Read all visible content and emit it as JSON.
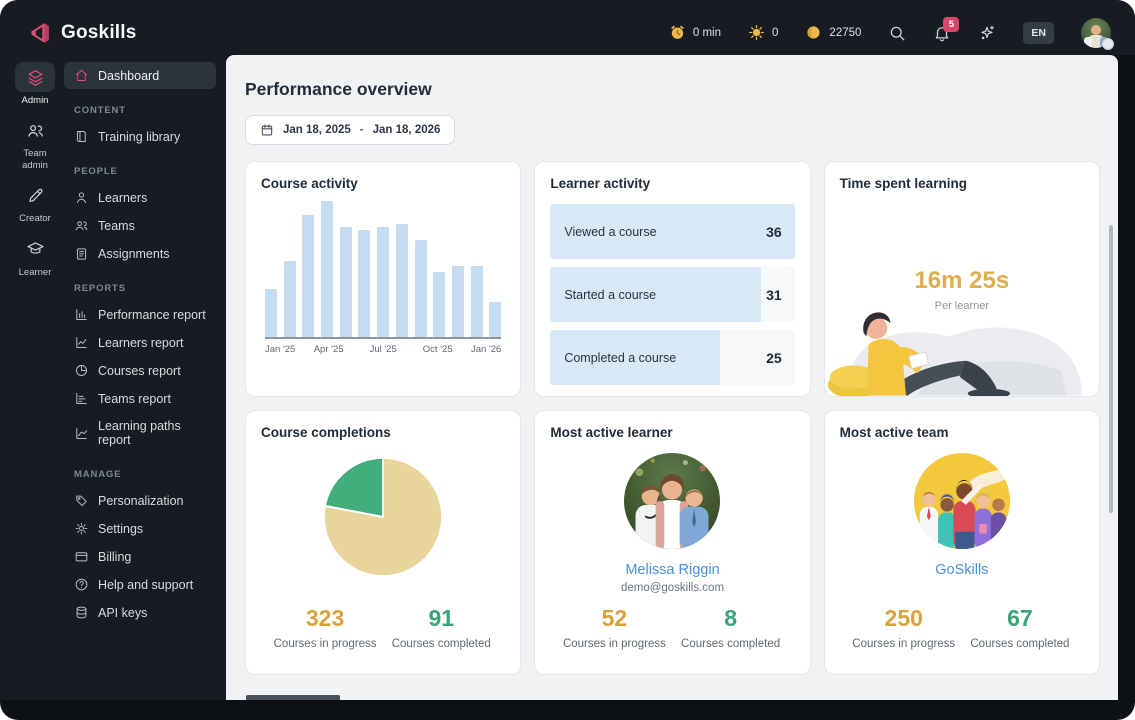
{
  "colors": {
    "accent": "#d94f72",
    "gold": "#d9a23c",
    "green": "#3aa475",
    "link_blue": "#4a90d8",
    "bar_blue": "#c4dbf0",
    "badge_red": "#d6466b"
  },
  "topbar": {
    "brand": "Goskills",
    "counters": [
      {
        "icon": "clock-icon",
        "label": "0 min"
      },
      {
        "icon": "sun-icon",
        "label": "0"
      },
      {
        "icon": "coin-icon",
        "label": "22750"
      }
    ],
    "notification_count": "5",
    "language": "EN"
  },
  "rail": {
    "items": [
      {
        "label": "Admin",
        "icon": "layers-icon",
        "active": true
      },
      {
        "label": "Team admin",
        "icon": "people-icon",
        "active": false
      },
      {
        "label": "Creator",
        "icon": "pencil-icon",
        "active": false
      },
      {
        "label": "Learner",
        "icon": "graduation-cap-icon",
        "active": false
      }
    ]
  },
  "sidebar": {
    "top_item": {
      "label": "Dashboard",
      "icon": "home-icon",
      "active": true
    },
    "sections": [
      {
        "header": "CONTENT",
        "items": [
          {
            "label": "Training library",
            "icon": "book-icon"
          }
        ]
      },
      {
        "header": "PEOPLE",
        "items": [
          {
            "label": "Learners",
            "icon": "person-icon"
          },
          {
            "label": "Teams",
            "icon": "people-icon"
          },
          {
            "label": "Assignments",
            "icon": "clipboard-icon"
          }
        ]
      },
      {
        "header": "REPORTS",
        "items": [
          {
            "label": "Performance report",
            "icon": "bar-chart-icon"
          },
          {
            "label": "Learners report",
            "icon": "line-chart-icon"
          },
          {
            "label": "Courses report",
            "icon": "pie-chart-icon"
          },
          {
            "label": "Teams report",
            "icon": "hbar-chart-icon"
          },
          {
            "label": "Learning paths report",
            "icon": "trend-chart-icon"
          }
        ]
      },
      {
        "header": "MANAGE",
        "items": [
          {
            "label": "Personalization",
            "icon": "tag-icon"
          },
          {
            "label": "Settings",
            "icon": "gear-icon"
          },
          {
            "label": "Billing",
            "icon": "credit-card-icon"
          },
          {
            "label": "Help and support",
            "icon": "help-icon"
          },
          {
            "label": "API keys",
            "icon": "database-icon"
          }
        ]
      }
    ]
  },
  "main": {
    "title": "Performance overview",
    "date_range": {
      "start": "Jan 18, 2025",
      "separator": "-",
      "end": "Jan 18, 2026"
    },
    "cards": {
      "course_activity": {
        "title": "Course activity"
      },
      "learner_activity": {
        "title": "Learner activity"
      },
      "time_spent": {
        "title": "Time spent learning",
        "value": "16m 25s",
        "caption": "Per learner"
      },
      "course_completions": {
        "title": "Course completions",
        "stats": [
          {
            "value": "323",
            "label": "Courses in progress",
            "color": "gold"
          },
          {
            "value": "91",
            "label": "Courses completed",
            "color": "green"
          }
        ]
      },
      "most_active_learner": {
        "title": "Most active learner",
        "name": "Melissa Riggin",
        "email": "demo@goskills.com",
        "stats": [
          {
            "value": "52",
            "label": "Courses in progress",
            "color": "gold"
          },
          {
            "value": "8",
            "label": "Courses completed",
            "color": "green"
          }
        ]
      },
      "most_active_team": {
        "title": "Most active team",
        "name": "GoSkills",
        "stats": [
          {
            "value": "250",
            "label": "Courses in progress",
            "color": "gold"
          },
          {
            "value": "67",
            "label": "Courses completed",
            "color": "green"
          }
        ]
      }
    }
  },
  "chart_data": [
    {
      "type": "bar",
      "title": "Course activity",
      "x": [
        "Jan '25",
        "Feb '25",
        "Mar '25",
        "Apr '25",
        "May '25",
        "Jun '25",
        "Jul '25",
        "Aug '25",
        "Sep '25",
        "Oct '25",
        "Nov '25",
        "Dec '25",
        "Jan '26"
      ],
      "values": [
        35,
        56,
        90,
        100,
        81,
        79,
        81,
        83,
        71,
        48,
        52,
        52,
        26
      ],
      "tick_labels": [
        "Jan '25",
        "Apr '25",
        "Jul '25",
        "Oct '25",
        "Jan '26"
      ],
      "ylim": [
        0,
        100
      ],
      "grid": false,
      "legend": false,
      "bar_color": "#c4dbf0"
    },
    {
      "type": "bar",
      "orientation": "horizontal",
      "title": "Learner activity",
      "categories": [
        "Viewed a course",
        "Started a course",
        "Completed a course"
      ],
      "values": [
        36,
        31,
        25
      ],
      "bar_color": "#d9e8f6"
    },
    {
      "type": "pie",
      "title": "Course completions",
      "labels": [
        "Courses in progress",
        "Courses completed"
      ],
      "values": [
        323,
        91
      ],
      "colors": [
        "#e9d49c",
        "#43ad7c"
      ]
    }
  ]
}
